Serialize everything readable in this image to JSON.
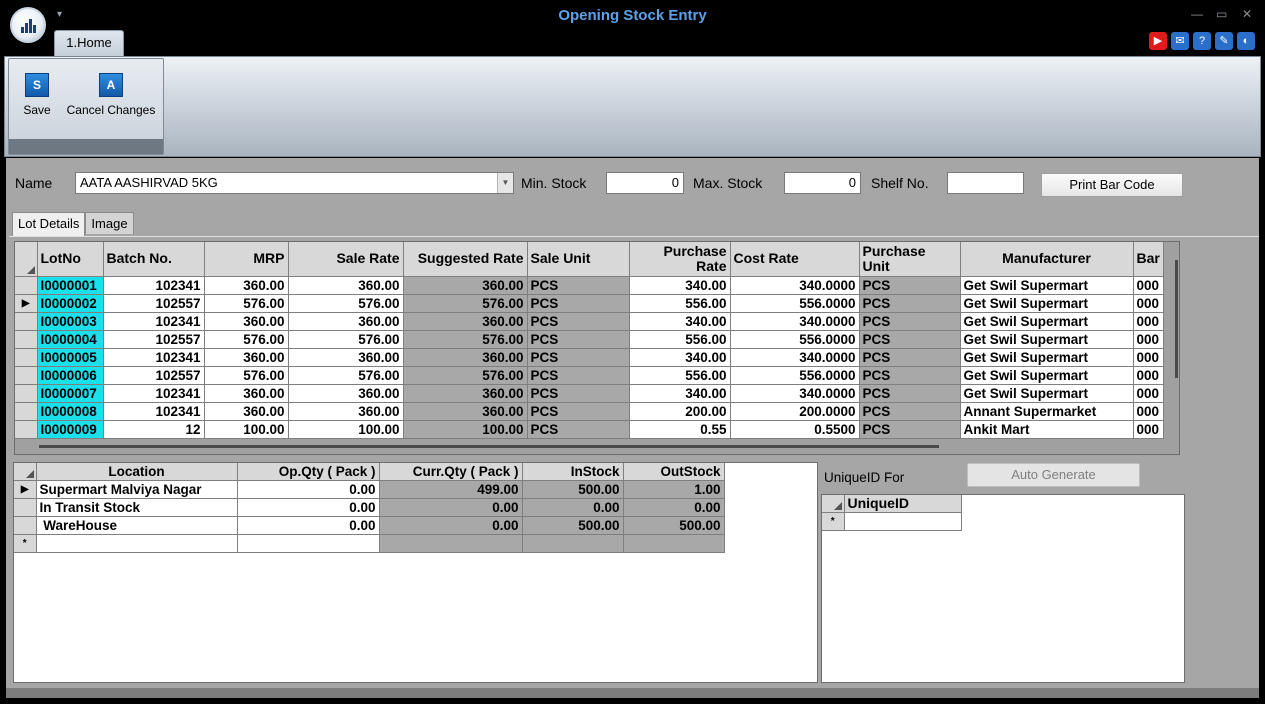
{
  "window": {
    "title": "Opening Stock Entry",
    "home_tab": "1.Home",
    "minimize": "—",
    "maximize": "▭",
    "close": "✕"
  },
  "toolbar": {
    "save_label": "Save",
    "cancel_label": "Cancel Changes"
  },
  "form": {
    "name_label": "Name",
    "name_value": "AATA AASHIRVAD 5KG",
    "min_stock_label": "Min. Stock",
    "min_stock_value": "0",
    "max_stock_label": "Max. Stock",
    "max_stock_value": "0",
    "shelf_label": "Shelf No.",
    "shelf_value": "",
    "print_barcode_label": "Print Bar Code"
  },
  "tabs": [
    "Lot Details",
    "Image"
  ],
  "lot_grid": {
    "columns": [
      "LotNo",
      "Batch No.",
      "MRP",
      "Sale Rate",
      "Suggested Rate",
      "Sale Unit",
      "Purchase Rate",
      "Cost Rate",
      "Purchase Unit",
      "Manufacturer",
      "Bar"
    ],
    "rows": [
      {
        "lot": "I0000001",
        "batch": "102341",
        "mrp": "360.00",
        "sale": "360.00",
        "sugg": "360.00",
        "unit": "PCS",
        "prate": "340.00",
        "cost": "340.0000",
        "punit": "PCS",
        "mfr": "Get Swil Supermart",
        "bar": "000"
      },
      {
        "lot": "I0000002",
        "batch": "102557",
        "mrp": "576.00",
        "sale": "576.00",
        "sugg": "576.00",
        "unit": "PCS",
        "prate": "556.00",
        "cost": "556.0000",
        "punit": "PCS",
        "mfr": "Get Swil Supermart",
        "bar": "000"
      },
      {
        "lot": "I0000003",
        "batch": "102341",
        "mrp": "360.00",
        "sale": "360.00",
        "sugg": "360.00",
        "unit": "PCS",
        "prate": "340.00",
        "cost": "340.0000",
        "punit": "PCS",
        "mfr": "Get Swil Supermart",
        "bar": "000"
      },
      {
        "lot": "I0000004",
        "batch": "102557",
        "mrp": "576.00",
        "sale": "576.00",
        "sugg": "576.00",
        "unit": "PCS",
        "prate": "556.00",
        "cost": "556.0000",
        "punit": "PCS",
        "mfr": "Get Swil Supermart",
        "bar": "000"
      },
      {
        "lot": "I0000005",
        "batch": "102341",
        "mrp": "360.00",
        "sale": "360.00",
        "sugg": "360.00",
        "unit": "PCS",
        "prate": "340.00",
        "cost": "340.0000",
        "punit": "PCS",
        "mfr": "Get Swil Supermart",
        "bar": "000"
      },
      {
        "lot": "I0000006",
        "batch": "102557",
        "mrp": "576.00",
        "sale": "576.00",
        "sugg": "576.00",
        "unit": "PCS",
        "prate": "556.00",
        "cost": "556.0000",
        "punit": "PCS",
        "mfr": "Get Swil Supermart",
        "bar": "000"
      },
      {
        "lot": "I0000007",
        "batch": "102341",
        "mrp": "360.00",
        "sale": "360.00",
        "sugg": "360.00",
        "unit": "PCS",
        "prate": "340.00",
        "cost": "340.0000",
        "punit": "PCS",
        "mfr": "Get Swil Supermart",
        "bar": "000"
      },
      {
        "lot": "I0000008",
        "batch": "102341",
        "mrp": "360.00",
        "sale": "360.00",
        "sugg": "360.00",
        "unit": "PCS",
        "prate": "200.00",
        "cost": "200.0000",
        "punit": "PCS",
        "mfr": "Annant Supermarket",
        "bar": "000"
      },
      {
        "lot": "I0000009",
        "batch": "12",
        "mrp": "100.00",
        "sale": "100.00",
        "sugg": "100.00",
        "unit": "PCS",
        "prate": "0.55",
        "cost": "0.5500",
        "punit": "PCS",
        "mfr": "Ankit Mart",
        "bar": "000"
      }
    ],
    "current_row": 1
  },
  "location_grid": {
    "columns": [
      "Location",
      "Op.Qty ( Pack )",
      "Curr.Qty ( Pack )",
      "InStock",
      "OutStock"
    ],
    "rows": [
      {
        "loc": "Supermart Malviya Nagar",
        "op": "0.00",
        "curr": "499.00",
        "in": "500.00",
        "out": "1.00"
      },
      {
        "loc": "In Transit Stock",
        "op": "0.00",
        "curr": "0.00",
        "in": "0.00",
        "out": "0.00"
      },
      {
        "loc": " WareHouse",
        "op": "0.00",
        "curr": "0.00",
        "in": "500.00",
        "out": "500.00"
      }
    ],
    "new_row_marker": "*"
  },
  "unique": {
    "label": "UniqueID For",
    "auto_generate_label": "Auto Generate",
    "column": "UniqueID",
    "new_row_marker": "*"
  },
  "colors": {
    "title": "#5ea2e8",
    "lot_highlight": "#19e0ea",
    "panel": "#a6a6a6"
  }
}
